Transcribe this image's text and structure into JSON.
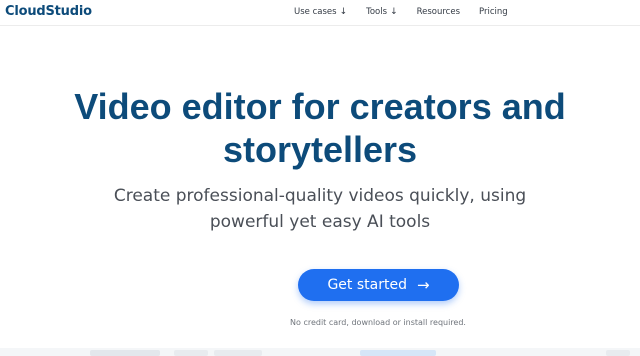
{
  "brand": {
    "name": "CloudStudio"
  },
  "nav": {
    "items": [
      {
        "label": "Use cases",
        "arrow": "↓"
      },
      {
        "label": "Tools",
        "arrow": "↓"
      },
      {
        "label": "Resources",
        "arrow": ""
      },
      {
        "label": "Pricing",
        "arrow": ""
      }
    ]
  },
  "hero": {
    "title_line1": "Video editor for creators and",
    "title_line2": "storytellers",
    "subtitle_line1": "Create professional-quality videos quickly, using",
    "subtitle_line2": "powerful yet easy AI tools",
    "cta_label": "Get started",
    "cta_icon": "arrow-right-icon",
    "cta_arrow": "→",
    "note": "No credit card, download or install required."
  },
  "colors": {
    "brand": "#0d4b7a",
    "accent": "#1f6ff0",
    "text": "#4a4f57"
  }
}
